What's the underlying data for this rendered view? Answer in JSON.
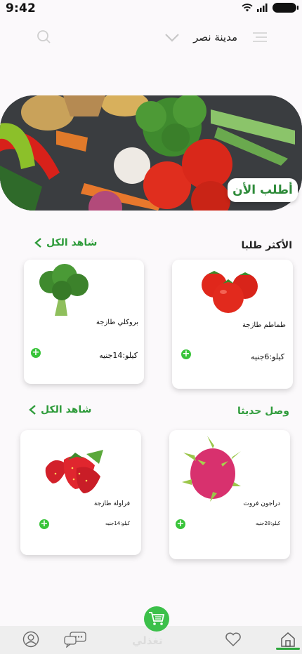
{
  "status_bar": {
    "time": "9:42"
  },
  "header": {
    "city": "مدينة نصر",
    "icons": [
      "search-icon",
      "chevron-down-icon",
      "menu-icon"
    ]
  },
  "hero": {
    "order_button": "أطلب الأن"
  },
  "most_ordered": {
    "title": "الأكثر طلبا",
    "see_all": "شاهد الكل",
    "items": [
      {
        "name": "طماطم طازجة",
        "price": "كيلو:6جنيه"
      },
      {
        "name": "بروكلي طازجة",
        "price": "كيلو:14جنيه"
      }
    ]
  },
  "new_arrivals": {
    "title": "وصل حديثا",
    "see_all": "شاهد الكل",
    "items": [
      {
        "name": "دراجون فروت",
        "price": "كيلو:28جنيه"
      },
      {
        "name": "فراولة طازجة",
        "price": "كيلو:14جنيه"
      }
    ]
  },
  "bottom_nav": {
    "brand": "تغذلي",
    "items": [
      "profile-icon",
      "chat-icon",
      "cart-icon",
      "heart-icon",
      "home-icon"
    ],
    "active": "home-icon"
  },
  "colors": {
    "accent": "#2e9b3a",
    "fab": "#3cc04a",
    "background": "#fbf9fb"
  }
}
